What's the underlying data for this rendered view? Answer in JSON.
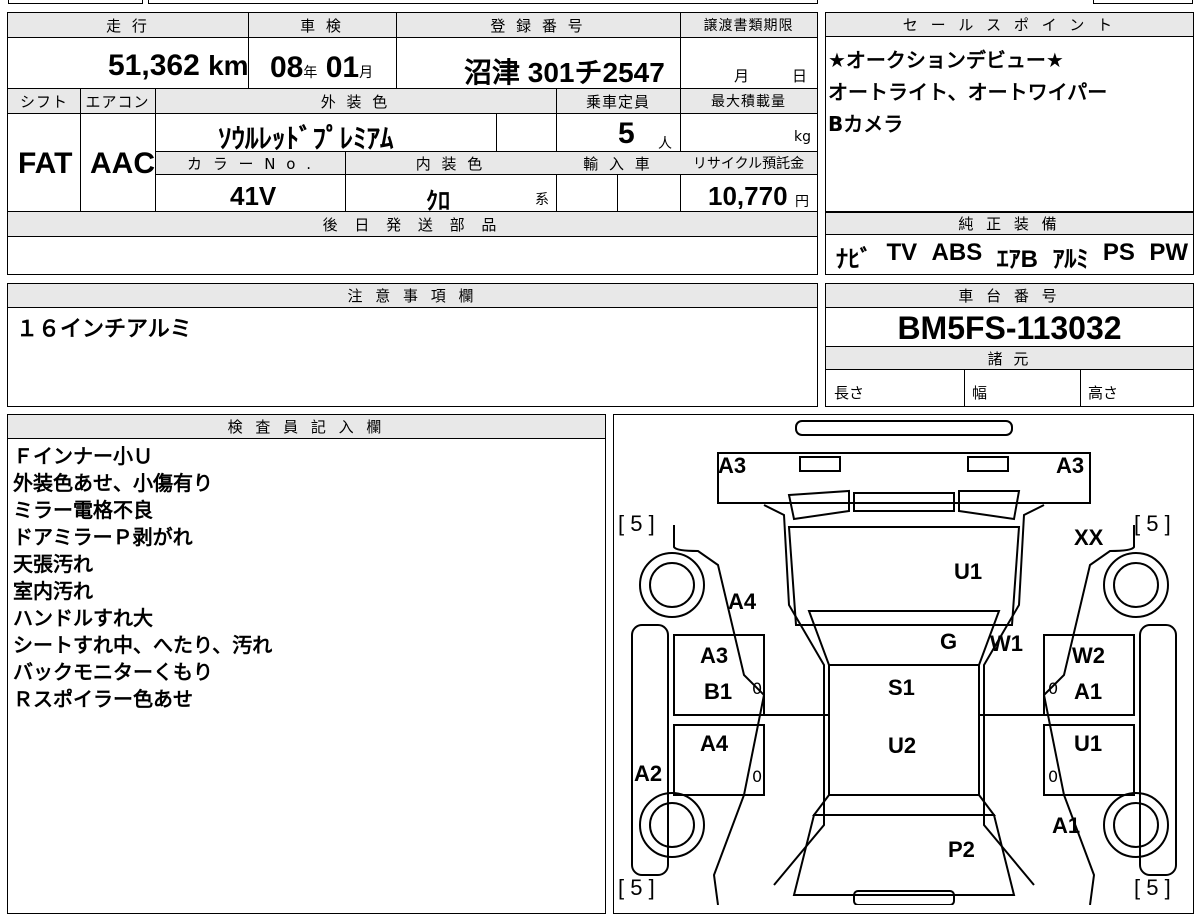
{
  "grid": {
    "mileage_label": "走 行",
    "mileage": "51,362",
    "mileage_unit": "km",
    "inspection_label": "車 検",
    "inspection_year": "08",
    "year_unit": "年",
    "inspection_month": "01",
    "month_unit": "月",
    "reg_label": "登 録 番 号",
    "reg_number": "沼津 301チ2547",
    "transfer_label": "譲渡書類期限",
    "transfer_month": "月",
    "transfer_day": "日",
    "shift_label": "シフト",
    "shift": "FAT",
    "ac_label": "エアコン",
    "ac": "AAC",
    "ext_color_label": "外 装 色",
    "ext_color": "ｿｳﾙﾚｯﾄﾞﾌﾟﾚﾐｱﾑ",
    "capacity_label": "乗車定員",
    "capacity": "5",
    "capacity_unit": "人",
    "maxload_label": "最大積載量",
    "maxload_unit": "kg",
    "color_no_label": "カ ラ ー N o .",
    "color_no": "41V",
    "int_color_label": "内 装 色",
    "int_color": "ｸﾛ",
    "int_color_unit": "系",
    "import_label": "輸 入 車",
    "recycle_label": "リサイクル預託金",
    "recycle_fee": "10,770",
    "recycle_unit": "円",
    "later_parts_label": "後 日 発 送 部 品"
  },
  "sales": {
    "label": "セ ー ル ス ポ イ ン ト",
    "lines": [
      "★オークションデビュー★",
      "オートライト、オートワイパー",
      "Bカメラ"
    ]
  },
  "equipment": {
    "label": "純 正 装 備",
    "items": [
      "ﾅﾋﾞ",
      "TV",
      "ABS",
      "ｴｱB",
      "ｱﾙﾐ",
      "PS",
      "PW"
    ]
  },
  "caution": {
    "label": "注 意 事 項 欄",
    "text": "１６インチアルミ"
  },
  "chassis": {
    "label": "車 台 番 号",
    "number": "BM5FS-113032",
    "specs_label": "諸 元",
    "length_label": "長さ",
    "width_label": "幅",
    "height_label": "高さ"
  },
  "inspector": {
    "label": "検 査 員 記 入 欄",
    "lines": [
      "Ｆインナー小Ｕ",
      "外装色あせ、小傷有り",
      "ミラー電格不良",
      "ドアミラーＰ剥がれ",
      "天張汚れ",
      "室内汚れ",
      "ハンドルすれ大",
      "シートすれ中、へたり、汚れ",
      "バックモニターくもり",
      "Ｒスポイラー色あせ"
    ]
  },
  "diagram": {
    "tire_tl": "[ 5 ]",
    "tire_tr": "[ 5 ]",
    "tire_bl": "[ 5 ]",
    "tire_br": "[ 5 ]",
    "marks": {
      "a3_left": "A3",
      "a3_right": "A3",
      "xx": "XX",
      "u1_hood": "U1",
      "a4_fender": "A4",
      "g": "G",
      "w1": "W1",
      "w2": "W2",
      "a3_door": "A3",
      "b1": "B1",
      "s1": "S1",
      "a1_door": "A1",
      "a4_door": "A4",
      "u2": "U2",
      "u1_door": "U1",
      "a2": "A2",
      "a1_rear": "A1",
      "p2": "P2",
      "zero1": "0",
      "zero2": "0",
      "zero3": "0",
      "zero4": "0"
    }
  }
}
